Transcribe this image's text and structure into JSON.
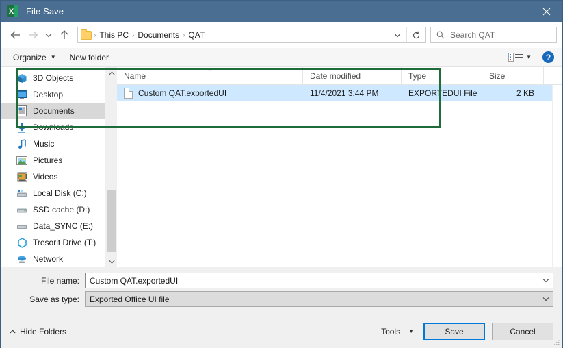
{
  "window": {
    "title": "File Save",
    "app_icon": "excel-icon",
    "close_label": "✕",
    "titlebar_color": "#4a6e91"
  },
  "nav": {
    "back": "←",
    "forward": "→",
    "recent": "⌄",
    "up": "↑",
    "breadcrumb": {
      "folder_icon": "folder-icon",
      "parts": [
        "This PC",
        "Documents",
        "QAT"
      ],
      "separator": "›",
      "dropdown": "⌄",
      "refresh": "↻"
    },
    "search": {
      "icon": "search-icon",
      "placeholder": "Search QAT"
    }
  },
  "toolbar": {
    "organize": "Organize",
    "organize_caret": "▼",
    "new_folder": "New folder",
    "view_icon": "view-options-icon",
    "view_caret": "▼",
    "help": "?"
  },
  "sidebar": {
    "items": [
      {
        "label": "3D Objects",
        "icon": "3d-objects-icon",
        "selected": false
      },
      {
        "label": "Desktop",
        "icon": "desktop-icon",
        "selected": false
      },
      {
        "label": "Documents",
        "icon": "documents-icon",
        "selected": true
      },
      {
        "label": "Downloads",
        "icon": "downloads-icon",
        "selected": false
      },
      {
        "label": "Music",
        "icon": "music-icon",
        "selected": false
      },
      {
        "label": "Pictures",
        "icon": "pictures-icon",
        "selected": false
      },
      {
        "label": "Videos",
        "icon": "videos-icon",
        "selected": false
      },
      {
        "label": "Local Disk (C:)",
        "icon": "hard-drive-icon",
        "selected": false
      },
      {
        "label": "SSD cache (D:)",
        "icon": "drive-icon",
        "selected": false
      },
      {
        "label": "Data_SYNC (E:)",
        "icon": "drive-icon",
        "selected": false
      },
      {
        "label": "Tresorit Drive (T:)",
        "icon": "tresorit-icon",
        "selected": false
      },
      {
        "label": "Network",
        "icon": "network-icon",
        "selected": false
      }
    ],
    "scroll_up": "⌃",
    "scroll_down": "⌄"
  },
  "filelist": {
    "columns": [
      {
        "label": "Name",
        "sorted": true,
        "sort_glyph": "⌃"
      },
      {
        "label": "Date modified",
        "sorted": false
      },
      {
        "label": "Type",
        "sorted": false
      },
      {
        "label": "Size",
        "sorted": false
      }
    ],
    "rows": [
      {
        "name": "Custom QAT.exportedUI",
        "date_modified": "11/4/2021 3:44 PM",
        "type": "EXPORTEDUI File",
        "size": "2 KB",
        "icon": "generic-file-icon",
        "selected": true
      }
    ],
    "highlight_color": "#1f6b3b"
  },
  "form": {
    "file_name_label": "File name:",
    "file_name_value": "Custom QAT.exportedUI",
    "save_as_type_label": "Save as type:",
    "save_as_type_value": "Exported Office UI file",
    "dropdown_glyph": "⌄"
  },
  "footer": {
    "hide_folders_caret": "⌃",
    "hide_folders": "Hide Folders",
    "tools": "Tools",
    "tools_caret": "▼",
    "save": "Save",
    "cancel": "Cancel"
  }
}
